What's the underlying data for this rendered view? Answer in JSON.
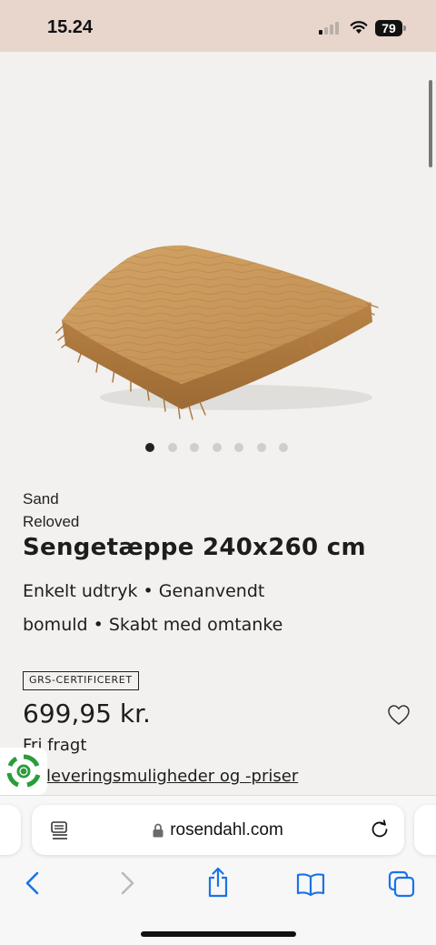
{
  "status": {
    "time": "15.24",
    "battery": "79"
  },
  "product": {
    "image_alt": "Sand colored blanket",
    "variant": "Sand",
    "collection": "Reloved",
    "title": "Sengetæppe 240x260 cm",
    "tagline_line1": "Enkelt udtryk  •  Genanvendt",
    "tagline_line2": "bomuld  •  Skabt med omtanke",
    "certification": "GRS-CERTIFICERET",
    "price": "699,95 kr.",
    "shipping": "Fri fragt",
    "delivery_link": "leveringsmuligheder og -priser",
    "carousel": {
      "total": 7,
      "active": 1
    }
  },
  "browser": {
    "url": "rosendahl.com"
  },
  "icons": {
    "signal": "signal-icon",
    "wifi": "wifi-icon",
    "battery": "battery-icon",
    "heart": "heart-icon",
    "eco": "eco-badge-icon",
    "reader": "reader-mode-icon",
    "lock": "lock-icon",
    "reload": "reload-icon",
    "back": "back-icon",
    "forward": "forward-icon",
    "share": "share-icon",
    "bookmarks": "bookmarks-icon",
    "tabs": "tabs-icon"
  },
  "colors": {
    "status_bar": "#e8d6cc",
    "page_bg": "#f2f1ef",
    "accent": "#1a73e8",
    "blanket": "#c99a5e"
  }
}
